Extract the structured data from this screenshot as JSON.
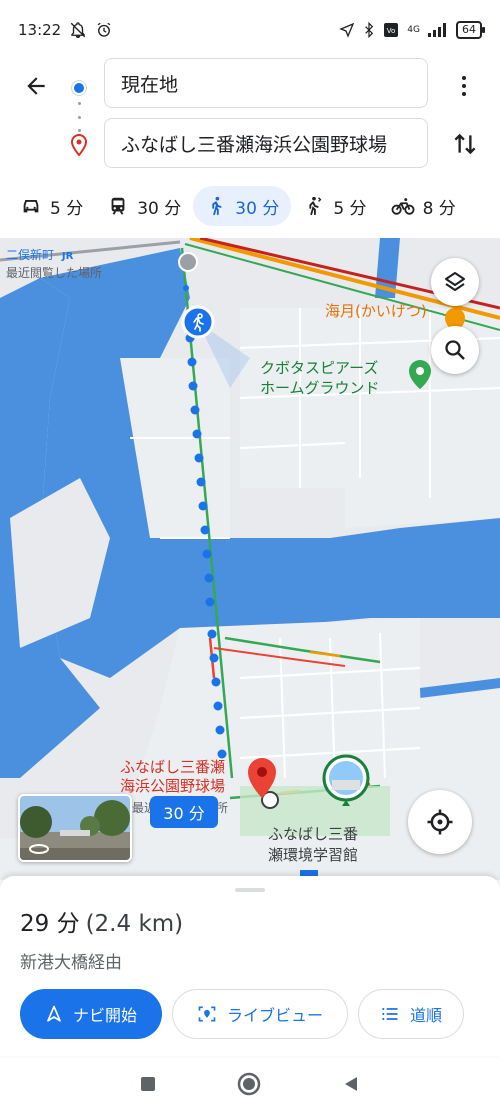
{
  "status_bar": {
    "time": "13:22",
    "battery": "64",
    "network": "4G"
  },
  "route": {
    "origin": "現在地",
    "destination": "ふなばし三番瀬海浜公園野球場"
  },
  "modes": [
    {
      "name": "car",
      "time": "5 分",
      "active": false
    },
    {
      "name": "transit",
      "time": "30 分",
      "active": false
    },
    {
      "name": "walk",
      "time": "30 分",
      "active": true
    },
    {
      "name": "rideshare",
      "time": "5 分",
      "active": false
    },
    {
      "name": "bike",
      "time": "8 分",
      "active": false
    }
  ],
  "map": {
    "station_label": "二俣新町",
    "recently_viewed_1": "最近閲覧した場所",
    "kaigetsu": "海月(かいげつ)",
    "kubota_line1": "クボタスピアーズ",
    "kubota_line2": "ホームグラウンド",
    "dest_line1": "ふなばし三番瀬",
    "dest_line2": "海浜公園野球場",
    "recently_viewed_2": "最近閲覧した場所",
    "time_chip": "30 分",
    "center_line1": "ふなばし三番",
    "center_line2": "瀬環境学習館",
    "colors": {
      "water": "#4b8fdf",
      "land": "#e8eaed",
      "route_dots": "#1a73e8",
      "pin": "#ea4335",
      "poi_green": "#188038"
    }
  },
  "sheet": {
    "duration": "29 分",
    "distance": "(2.4 km)",
    "via": "新港大橋経由",
    "start_label": "ナビ開始",
    "live_label": "ライブビュー",
    "steps_label": "道順"
  }
}
